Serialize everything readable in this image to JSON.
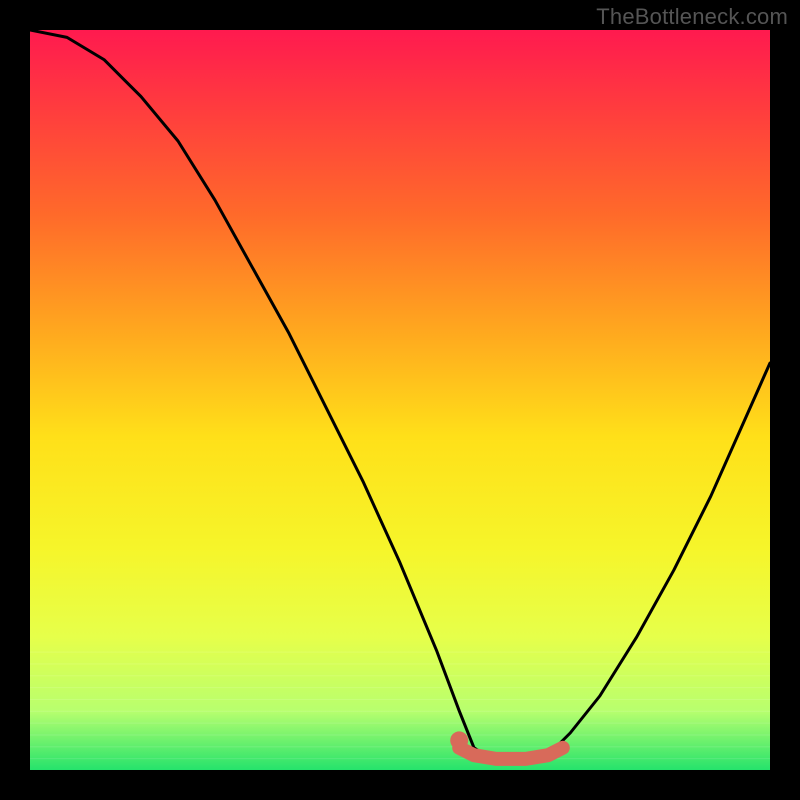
{
  "watermark": "TheBottleneck.com",
  "chart_data": {
    "type": "line",
    "title": "",
    "xlabel": "",
    "ylabel": "",
    "xlim": [
      0,
      100
    ],
    "ylim": [
      0,
      100
    ],
    "grid": false,
    "gradient_stops": [
      {
        "offset": 0.0,
        "color": "#ff1a4f"
      },
      {
        "offset": 0.1,
        "color": "#ff3a3f"
      },
      {
        "offset": 0.25,
        "color": "#ff6a2a"
      },
      {
        "offset": 0.4,
        "color": "#ffa51f"
      },
      {
        "offset": 0.55,
        "color": "#ffe019"
      },
      {
        "offset": 0.7,
        "color": "#f6f52a"
      },
      {
        "offset": 0.82,
        "color": "#e6ff4a"
      },
      {
        "offset": 0.92,
        "color": "#b8ff6e"
      },
      {
        "offset": 1.0,
        "color": "#25e36c"
      }
    ],
    "series": [
      {
        "name": "bottleneck-curve",
        "color": "#000000",
        "stroke_width": 3,
        "x": [
          0,
          5,
          10,
          15,
          20,
          25,
          30,
          35,
          40,
          45,
          50,
          55,
          58,
          60,
          63,
          67,
          70,
          73,
          77,
          82,
          87,
          92,
          96,
          100
        ],
        "values": [
          100,
          99,
          96,
          91,
          85,
          77,
          68,
          59,
          49,
          39,
          28,
          16,
          8,
          3,
          1,
          1,
          2,
          5,
          10,
          18,
          27,
          37,
          46,
          55
        ]
      },
      {
        "name": "optimal-band",
        "color": "#d86a5a",
        "stroke_width": 14,
        "x": [
          58,
          60,
          63,
          67,
          70,
          72
        ],
        "values": [
          3,
          2,
          1.5,
          1.5,
          2,
          3
        ]
      },
      {
        "name": "optimal-start-point",
        "type": "scatter",
        "color": "#d86a5a",
        "radius": 9,
        "x": [
          58
        ],
        "values": [
          4
        ]
      }
    ]
  }
}
